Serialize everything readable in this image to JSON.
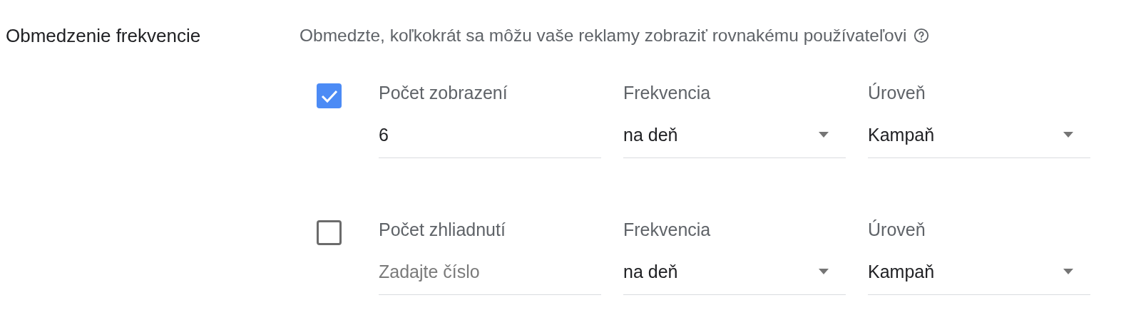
{
  "section": {
    "label": "Obmedzenie frekvencie",
    "description": "Obmedzte, koľkokrát sa môžu vaše reklamy zobraziť rovnakému používateľovi"
  },
  "rows": [
    {
      "checked": true,
      "count": {
        "label": "Počet zobrazení",
        "value": "6"
      },
      "frequency": {
        "label": "Frekvencia",
        "value": "na deň"
      },
      "level_select": {
        "label": "Úroveň",
        "value": "Kampaň"
      }
    },
    {
      "checked": false,
      "count": {
        "label": "Počet zhliadnutí",
        "placeholder": "Zadajte číslo"
      },
      "frequency": {
        "label": "Frekvencia",
        "value": "na deň"
      },
      "level_select": {
        "label": "Úroveň",
        "value": "Kampaň"
      }
    }
  ]
}
